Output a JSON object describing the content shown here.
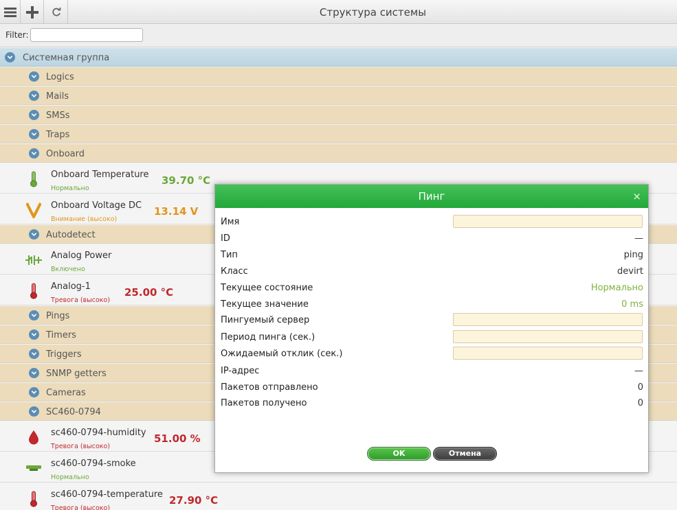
{
  "toolbar": {
    "title": "Структура системы",
    "icons": [
      "menu-icon",
      "plus-icon",
      "refresh-icon"
    ]
  },
  "filter": {
    "label": "Filter:",
    "value": ""
  },
  "tree": {
    "root": "Системная группа",
    "groups": {
      "logics": "Logics",
      "mails": "Mails",
      "smss": "SMSs",
      "traps": "Traps",
      "onboard": "Onboard",
      "autodetect": "Autodetect",
      "pings": "Pings",
      "timers": "Timers",
      "triggers": "Triggers",
      "snmp": "SNMP getters",
      "cameras": "Cameras",
      "sc460": "SC460-0794"
    },
    "sensors": {
      "onboard_temp": {
        "name": "Onboard Temperature",
        "status": "Нормально",
        "value": "39.70 °C"
      },
      "onboard_volt": {
        "name": "Onboard Voltage DC",
        "status": "Внимание (высоко)",
        "value": "13.14 V"
      },
      "analog_power": {
        "name": "Analog Power",
        "status": "Включено",
        "value": ""
      },
      "analog_1": {
        "name": "Analog-1",
        "status": "Тревога (высоко)",
        "value": "25.00 °C"
      },
      "humidity": {
        "name": "sc460-0794-humidity",
        "status": "Тревога (высоко)",
        "value": "51.00 %"
      },
      "smoke": {
        "name": "sc460-0794-smoke",
        "status": "Нормально",
        "value": ""
      },
      "temperature": {
        "name": "sc460-0794-temperature",
        "status": "Тревога (высоко)",
        "value": "27.90 °C"
      }
    }
  },
  "modal": {
    "title": "Пинг",
    "close": "×",
    "fields": {
      "name": {
        "label": "Имя",
        "value": ""
      },
      "id": {
        "label": "ID",
        "value": "—"
      },
      "type": {
        "label": "Тип",
        "value": "ping"
      },
      "class": {
        "label": "Класс",
        "value": "devirt"
      },
      "state": {
        "label": "Текущее состояние",
        "value": "Нормально"
      },
      "current": {
        "label": "Текущее значение",
        "value": "0 ms"
      },
      "server": {
        "label": "Пингуемый сервер",
        "value": ""
      },
      "period": {
        "label": "Период пинга (сек.)",
        "value": ""
      },
      "timeout": {
        "label": "Ожидаемый отклик (сек.)",
        "value": ""
      },
      "ip": {
        "label": "IP-адрес",
        "value": "—"
      },
      "sent": {
        "label": "Пакетов отправлено",
        "value": "0"
      },
      "received": {
        "label": "Пакетов получено",
        "value": "0"
      }
    },
    "ok_label": "OK",
    "cancel_label": "Отмена"
  },
  "colors": {
    "accent_green": "#2fae45",
    "status_ok": "#6aa83a",
    "status_warn": "#e0961a",
    "status_alarm": "#c0282c",
    "group_bg": "#ecdcbc",
    "root_bg": "#c6dbe6"
  }
}
